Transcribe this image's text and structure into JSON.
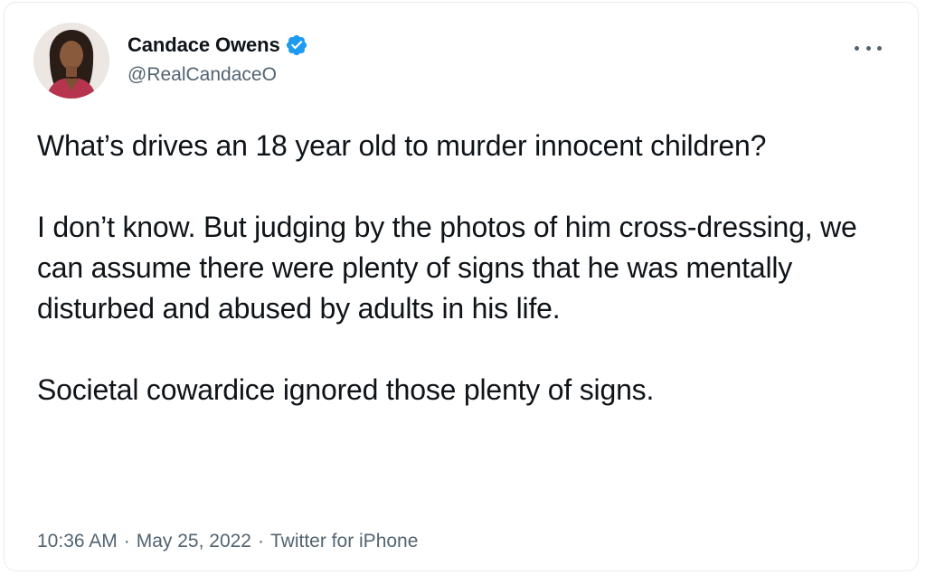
{
  "author": {
    "display_name": "Candace Owens",
    "handle": "@RealCandaceO",
    "verified": true,
    "avatar_icon": "profile-photo",
    "verified_icon": "verified-badge-icon",
    "verified_color": "#1d9bf0"
  },
  "menu": {
    "icon": "more-options-icon"
  },
  "tweet": {
    "paragraphs": [
      "What’s drives an 18 year old to murder innocent children?",
      "I don’t know. But judging by the photos of him cross-dressing, we can assume there were plenty of signs that he was mentally disturbed and abused by adults in his life.",
      "Societal cowardice ignored those plenty of signs."
    ]
  },
  "meta": {
    "time": "10:36 AM",
    "separator": "·",
    "date": "May 25, 2022",
    "source": "Twitter for iPhone"
  },
  "colors": {
    "text_primary": "#0f1419",
    "text_secondary": "#536471",
    "border": "#e6ecf0"
  }
}
